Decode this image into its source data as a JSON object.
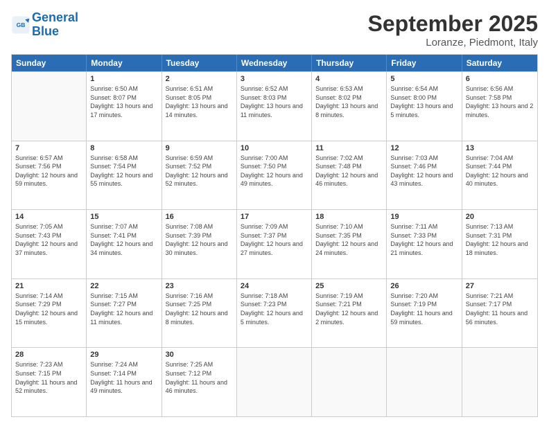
{
  "header": {
    "logo_line1": "General",
    "logo_line2": "Blue",
    "month": "September 2025",
    "location": "Loranze, Piedmont, Italy"
  },
  "weekdays": [
    "Sunday",
    "Monday",
    "Tuesday",
    "Wednesday",
    "Thursday",
    "Friday",
    "Saturday"
  ],
  "weeks": [
    [
      {
        "day": "",
        "empty": true
      },
      {
        "day": "1",
        "sunrise": "6:50 AM",
        "sunset": "8:07 PM",
        "daylight": "13 hours and 17 minutes."
      },
      {
        "day": "2",
        "sunrise": "6:51 AM",
        "sunset": "8:05 PM",
        "daylight": "13 hours and 14 minutes."
      },
      {
        "day": "3",
        "sunrise": "6:52 AM",
        "sunset": "8:03 PM",
        "daylight": "13 hours and 11 minutes."
      },
      {
        "day": "4",
        "sunrise": "6:53 AM",
        "sunset": "8:02 PM",
        "daylight": "13 hours and 8 minutes."
      },
      {
        "day": "5",
        "sunrise": "6:54 AM",
        "sunset": "8:00 PM",
        "daylight": "13 hours and 5 minutes."
      },
      {
        "day": "6",
        "sunrise": "6:56 AM",
        "sunset": "7:58 PM",
        "daylight": "13 hours and 2 minutes."
      }
    ],
    [
      {
        "day": "7",
        "sunrise": "6:57 AM",
        "sunset": "7:56 PM",
        "daylight": "12 hours and 59 minutes."
      },
      {
        "day": "8",
        "sunrise": "6:58 AM",
        "sunset": "7:54 PM",
        "daylight": "12 hours and 55 minutes."
      },
      {
        "day": "9",
        "sunrise": "6:59 AM",
        "sunset": "7:52 PM",
        "daylight": "12 hours and 52 minutes."
      },
      {
        "day": "10",
        "sunrise": "7:00 AM",
        "sunset": "7:50 PM",
        "daylight": "12 hours and 49 minutes."
      },
      {
        "day": "11",
        "sunrise": "7:02 AM",
        "sunset": "7:48 PM",
        "daylight": "12 hours and 46 minutes."
      },
      {
        "day": "12",
        "sunrise": "7:03 AM",
        "sunset": "7:46 PM",
        "daylight": "12 hours and 43 minutes."
      },
      {
        "day": "13",
        "sunrise": "7:04 AM",
        "sunset": "7:44 PM",
        "daylight": "12 hours and 40 minutes."
      }
    ],
    [
      {
        "day": "14",
        "sunrise": "7:05 AM",
        "sunset": "7:43 PM",
        "daylight": "12 hours and 37 minutes."
      },
      {
        "day": "15",
        "sunrise": "7:07 AM",
        "sunset": "7:41 PM",
        "daylight": "12 hours and 34 minutes."
      },
      {
        "day": "16",
        "sunrise": "7:08 AM",
        "sunset": "7:39 PM",
        "daylight": "12 hours and 30 minutes."
      },
      {
        "day": "17",
        "sunrise": "7:09 AM",
        "sunset": "7:37 PM",
        "daylight": "12 hours and 27 minutes."
      },
      {
        "day": "18",
        "sunrise": "7:10 AM",
        "sunset": "7:35 PM",
        "daylight": "12 hours and 24 minutes."
      },
      {
        "day": "19",
        "sunrise": "7:11 AM",
        "sunset": "7:33 PM",
        "daylight": "12 hours and 21 minutes."
      },
      {
        "day": "20",
        "sunrise": "7:13 AM",
        "sunset": "7:31 PM",
        "daylight": "12 hours and 18 minutes."
      }
    ],
    [
      {
        "day": "21",
        "sunrise": "7:14 AM",
        "sunset": "7:29 PM",
        "daylight": "12 hours and 15 minutes."
      },
      {
        "day": "22",
        "sunrise": "7:15 AM",
        "sunset": "7:27 PM",
        "daylight": "12 hours and 11 minutes."
      },
      {
        "day": "23",
        "sunrise": "7:16 AM",
        "sunset": "7:25 PM",
        "daylight": "12 hours and 8 minutes."
      },
      {
        "day": "24",
        "sunrise": "7:18 AM",
        "sunset": "7:23 PM",
        "daylight": "12 hours and 5 minutes."
      },
      {
        "day": "25",
        "sunrise": "7:19 AM",
        "sunset": "7:21 PM",
        "daylight": "12 hours and 2 minutes."
      },
      {
        "day": "26",
        "sunrise": "7:20 AM",
        "sunset": "7:19 PM",
        "daylight": "11 hours and 59 minutes."
      },
      {
        "day": "27",
        "sunrise": "7:21 AM",
        "sunset": "7:17 PM",
        "daylight": "11 hours and 56 minutes."
      }
    ],
    [
      {
        "day": "28",
        "sunrise": "7:23 AM",
        "sunset": "7:15 PM",
        "daylight": "11 hours and 52 minutes."
      },
      {
        "day": "29",
        "sunrise": "7:24 AM",
        "sunset": "7:14 PM",
        "daylight": "11 hours and 49 minutes."
      },
      {
        "day": "30",
        "sunrise": "7:25 AM",
        "sunset": "7:12 PM",
        "daylight": "11 hours and 46 minutes."
      },
      {
        "day": "",
        "empty": true
      },
      {
        "day": "",
        "empty": true
      },
      {
        "day": "",
        "empty": true
      },
      {
        "day": "",
        "empty": true
      }
    ]
  ]
}
